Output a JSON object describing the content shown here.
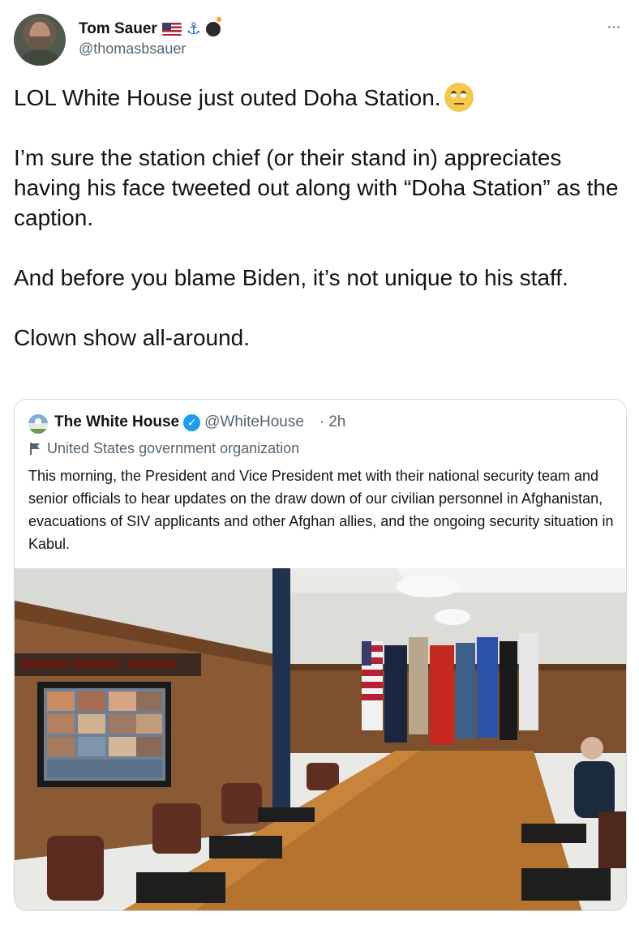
{
  "tweet": {
    "author": {
      "name": "Tom Sauer",
      "handle": "@thomasbsauer",
      "name_emojis": [
        "us-flag-icon",
        "anchor-icon",
        "bomb-icon"
      ]
    },
    "more_label": "···",
    "text": {
      "p1": "LOL White House just outed Doha Station.",
      "p1_emoji": "face-with-rolling-eyes-icon",
      "p2": "I’m sure the station chief (or their stand in) appreciates having his face tweeted out along with “Doha Station” as the caption.",
      "p3": "And before you blame Biden, it’s not unique to his staff.",
      "p4": "Clown show all-around."
    }
  },
  "quoted": {
    "name": "The White House",
    "handle": "@WhiteHouse",
    "separator": "·",
    "time": "2h",
    "label": "United States government organization",
    "text": "This morning, the President and Vice President met with their national security team and senior officials to hear updates on the draw down of our civilian personnel in Afghanistan, evacuations of SIV applicants and other Afghan allies, and the ongoing security situation in Kabul.",
    "verified_icon": "✓",
    "photo": "situation-room-photo"
  },
  "colors": {
    "text": "#0f1419",
    "secondary": "#536471",
    "border": "#cfd9de",
    "verified": "#1d9bf0"
  }
}
